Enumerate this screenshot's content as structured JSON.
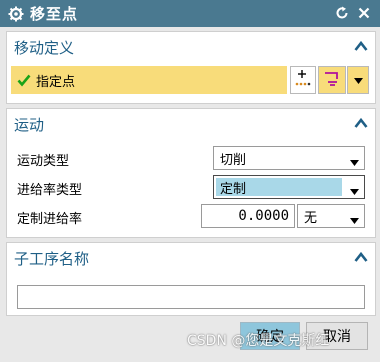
{
  "window": {
    "title": "移至点"
  },
  "sections": {
    "move_definition": {
      "title": "移动定义",
      "specify_point_label": "指定点"
    },
    "motion": {
      "title": "运动",
      "motion_type_label": "运动类型",
      "motion_type_value": "切削",
      "feed_type_label": "进给率类型",
      "feed_type_value": "定制",
      "custom_feed_label": "定制进给率",
      "custom_feed_value": "0.0000",
      "unit_value": "无"
    },
    "subprocess": {
      "title": "子工序名称",
      "name_value": ""
    }
  },
  "buttons": {
    "ok": "确定",
    "cancel": "取消"
  },
  "watermark": "CSDN @您是文克斯红",
  "colors": {
    "titlebar": "#4a7990",
    "section_title": "#1f5f86",
    "highlight": "#f8dc7a",
    "selection": "#a9d8e8"
  }
}
